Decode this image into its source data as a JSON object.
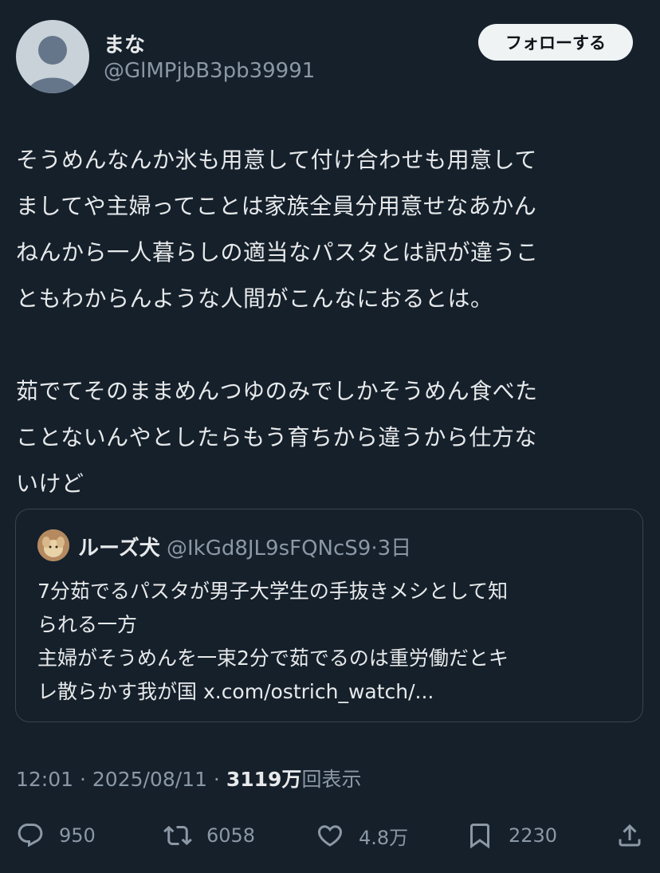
{
  "author": {
    "name": "まな",
    "handle": "@GlMPjbB3pb39991",
    "follow_label": "フォローする"
  },
  "post": {
    "text": "そうめんなんか氷も用意して付け合わせも用意して\nましてや主婦ってことは家族全員分用意せなあかん\nねんから一人暮らしの適当なパスタとは訳が違うこ\nともわからんような人間がこんなにおるとは。\n\n茹でてそのままめんつゆのみでしかそうめん食べた\nことないんやとしたらもう育ちから違うから仕方な\nいけど"
  },
  "quote": {
    "name": "ルーズ犬",
    "handle": "@IkGd8JL9sFQNcS9",
    "time": "3日",
    "text": "7分茹でるパスタが男子大学生の手抜きメシとして知\nられる一方\n主婦がそうめんを一束2分で茹でるのは重労働だとキ\nレ散らかす我が国 x.com/ostrich_watch/..."
  },
  "meta": {
    "time": "12:01",
    "date": "2025/08/11",
    "views_count": "3119",
    "views_unit": "万",
    "views_label": "回表示"
  },
  "actions": {
    "replies": "950",
    "reposts": "6058",
    "likes": "4.8万",
    "bookmarks": "2230"
  },
  "icons": {
    "reply": "reply-icon",
    "repost": "repost-icon",
    "like": "heart-icon",
    "bookmark": "bookmark-icon",
    "share": "share-icon"
  }
}
